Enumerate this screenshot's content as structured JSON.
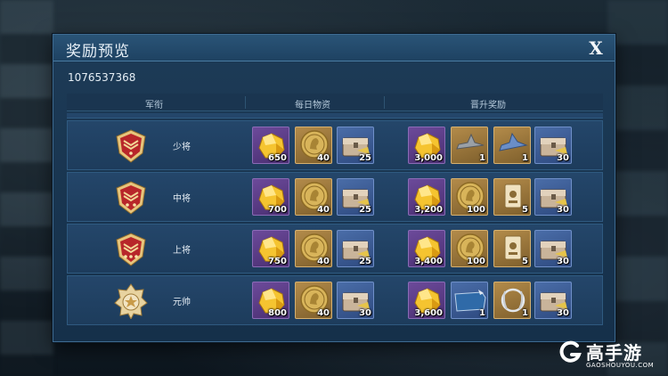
{
  "dialog": {
    "title": "奖励预览",
    "close_label": "X",
    "user_id": "1076537368"
  },
  "columns": {
    "rank": "军衔",
    "daily": "每日物资",
    "promotion": "晋升奖励"
  },
  "rows": [
    {
      "rank": "少将",
      "badge": "major-general-badge",
      "daily": [
        {
          "icon": "gold-gem-icon",
          "qty": "650",
          "frame": "purple"
        },
        {
          "icon": "gold-coin-icon",
          "qty": "40",
          "frame": "gold"
        },
        {
          "icon": "supply-chest-icon",
          "qty": "25",
          "frame": "blue"
        }
      ],
      "promotion": [
        {
          "icon": "gold-gem-icon",
          "qty": "3,000",
          "frame": "purple"
        },
        {
          "icon": "fighter-jet-icon",
          "qty": "1",
          "frame": "gold"
        },
        {
          "icon": "fighter-jet-blue-icon",
          "qty": "1",
          "frame": "gold"
        },
        {
          "icon": "supply-chest-icon",
          "qty": "30",
          "frame": "blue"
        }
      ]
    },
    {
      "rank": "中将",
      "badge": "lieutenant-general-badge",
      "daily": [
        {
          "icon": "gold-gem-icon",
          "qty": "700",
          "frame": "purple"
        },
        {
          "icon": "gold-coin-icon",
          "qty": "40",
          "frame": "gold"
        },
        {
          "icon": "supply-chest-icon",
          "qty": "25",
          "frame": "blue"
        }
      ],
      "promotion": [
        {
          "icon": "gold-gem-icon",
          "qty": "3,200",
          "frame": "purple"
        },
        {
          "icon": "gold-coin-icon",
          "qty": "100",
          "frame": "gold"
        },
        {
          "icon": "card-icon",
          "qty": "5",
          "frame": "gold"
        },
        {
          "icon": "supply-chest-icon",
          "qty": "30",
          "frame": "blue"
        }
      ]
    },
    {
      "rank": "上将",
      "badge": "general-badge",
      "daily": [
        {
          "icon": "gold-gem-icon",
          "qty": "750",
          "frame": "purple"
        },
        {
          "icon": "gold-coin-icon",
          "qty": "40",
          "frame": "gold"
        },
        {
          "icon": "supply-chest-icon",
          "qty": "25",
          "frame": "blue"
        }
      ],
      "promotion": [
        {
          "icon": "gold-gem-icon",
          "qty": "3,400",
          "frame": "purple"
        },
        {
          "icon": "gold-coin-icon",
          "qty": "100",
          "frame": "gold"
        },
        {
          "icon": "card-icon",
          "qty": "5",
          "frame": "gold"
        },
        {
          "icon": "supply-chest-icon",
          "qty": "30",
          "frame": "blue"
        }
      ]
    },
    {
      "rank": "元帅",
      "badge": "marshal-badge",
      "daily": [
        {
          "icon": "gold-gem-icon",
          "qty": "800",
          "frame": "purple"
        },
        {
          "icon": "gold-coin-icon",
          "qty": "40",
          "frame": "gold"
        },
        {
          "icon": "supply-chest-icon",
          "qty": "30",
          "frame": "blue"
        }
      ],
      "promotion": [
        {
          "icon": "gold-gem-icon",
          "qty": "3,600",
          "frame": "purple"
        },
        {
          "icon": "nameplate-icon",
          "qty": "1",
          "frame": "blue"
        },
        {
          "icon": "laurel-frame-icon",
          "qty": "1",
          "frame": "gold"
        },
        {
          "icon": "supply-chest-icon",
          "qty": "30",
          "frame": "blue"
        }
      ]
    }
  ],
  "watermark": {
    "name": "高手游",
    "site": "GAOSHOUYOU.COM"
  }
}
